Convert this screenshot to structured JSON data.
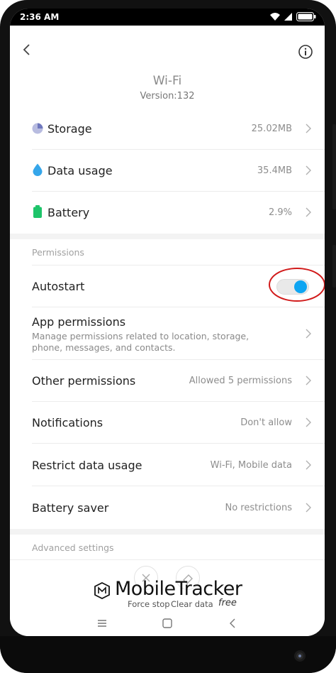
{
  "status_bar": {
    "time": "2:36 AM",
    "icons": [
      "wifi-icon",
      "signal-icon",
      "battery-icon"
    ]
  },
  "header": {
    "title": "Wi-Fi",
    "subtitle": "Version:132",
    "back_icon": "chevron-left-icon",
    "info_icon": "info-icon"
  },
  "usage": [
    {
      "label": "Storage",
      "value": "25.02MB",
      "icon": "storage-pie-icon",
      "color": "#8e95c9"
    },
    {
      "label": "Data usage",
      "value": "35.4MB",
      "icon": "water-drop-icon",
      "color": "#35a6ea"
    },
    {
      "label": "Battery",
      "value": "2.9%",
      "icon": "battery-icon",
      "color": "#1ec46a"
    }
  ],
  "permissions": {
    "section_label": "Permissions",
    "autostart": {
      "label": "Autostart",
      "enabled": true
    },
    "app_permissions": {
      "label": "App permissions",
      "description": "Manage permissions related to location, storage, phone, messages, and contacts."
    },
    "rows": [
      {
        "label": "Other permissions",
        "value": "Allowed 5 permissions"
      },
      {
        "label": "Notifications",
        "value": "Don't allow"
      },
      {
        "label": "Restrict data usage",
        "value": "Wi-Fi, Mobile data"
      },
      {
        "label": "Battery saver",
        "value": "No restrictions"
      }
    ]
  },
  "advanced": {
    "section_label": "Advanced settings"
  },
  "actions": {
    "force_stop": "Force stop",
    "clear_data": "Clear data"
  },
  "watermark": {
    "text": "MobileTracker",
    "free": "free"
  },
  "colors": {
    "accent": "#0ea5f2",
    "annotation_ring": "#d11a1a"
  }
}
